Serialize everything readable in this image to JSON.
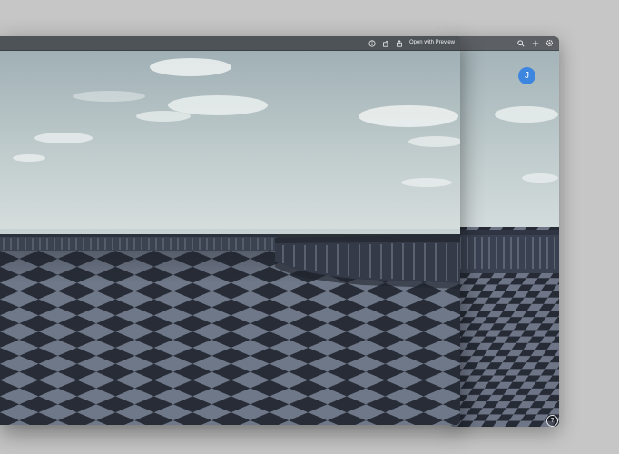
{
  "back_window": {
    "toolbar": {
      "icons": [
        "search-icon",
        "plus-icon",
        "gear-icon"
      ]
    },
    "avatar_initial": "J",
    "help_label": "?"
  },
  "front_window": {
    "toolbar": {
      "icons": [
        "info-icon",
        "rotate-icon",
        "share-icon"
      ],
      "open_with_preview_label": "Open with Preview"
    }
  },
  "colors": {
    "desktop": "#c6c6c6",
    "avatar": "#3d86e0",
    "sky_top": "#a7b7bb",
    "sky_bottom": "#d3dcdc",
    "floor_dark": "#2a2f3a",
    "floor_light": "#6a7384"
  }
}
